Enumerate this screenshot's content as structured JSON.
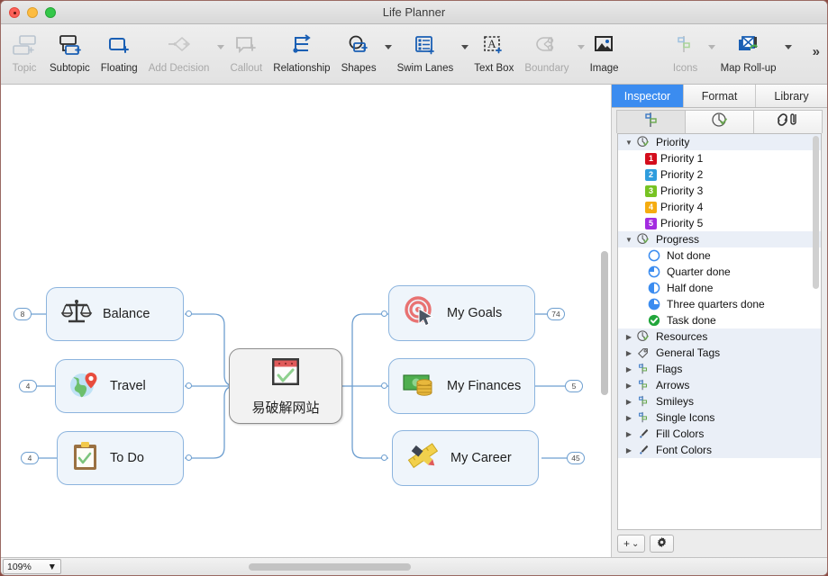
{
  "window": {
    "title": "Life Planner"
  },
  "traffic_lights": [
    {
      "name": "close",
      "color": "#fc6058"
    },
    {
      "name": "minimize",
      "color": "#fdbc40"
    },
    {
      "name": "zoom",
      "color": "#34c749"
    }
  ],
  "toolbar": {
    "items": [
      {
        "label": "Topic",
        "icon": "add-topic-icon",
        "enabled": false,
        "caret": false
      },
      {
        "label": "Subtopic",
        "icon": "add-subtopic-icon",
        "enabled": true,
        "caret": false
      },
      {
        "label": "Floating",
        "icon": "floating-topic-icon",
        "enabled": true,
        "caret": false
      },
      {
        "label": "Add Decision",
        "icon": "add-decision-icon",
        "enabled": false,
        "caret": true
      },
      {
        "label": "Callout",
        "icon": "callout-icon",
        "enabled": false,
        "caret": false
      },
      {
        "label": "Relationship",
        "icon": "relationship-icon",
        "enabled": true,
        "caret": false
      },
      {
        "label": "Shapes",
        "icon": "shapes-icon",
        "enabled": true,
        "caret": true
      },
      {
        "label": "Swim Lanes",
        "icon": "swim-lanes-icon",
        "enabled": true,
        "caret": true
      },
      {
        "label": "Text Box",
        "icon": "text-box-icon",
        "enabled": true,
        "caret": false
      },
      {
        "label": "Boundary",
        "icon": "boundary-icon",
        "enabled": false,
        "caret": true
      },
      {
        "label": "Image",
        "icon": "image-icon",
        "enabled": true,
        "caret": false
      },
      {
        "label": "Icons",
        "icon": "icons-icon",
        "enabled": false,
        "caret": true
      },
      {
        "label": "Map Roll-up",
        "icon": "map-rollup-icon",
        "enabled": true,
        "caret": true
      }
    ],
    "overflow_label": "»"
  },
  "canvas": {
    "center_node": {
      "label": "易破解网站",
      "icon": "calendar-check-icon"
    },
    "left_nodes": [
      {
        "label": "Balance",
        "icon": "scales-icon",
        "badge": "8"
      },
      {
        "label": "Travel",
        "icon": "globe-pin-icon",
        "badge": "4"
      },
      {
        "label": "To Do",
        "icon": "clipboard-check-icon",
        "badge": "4"
      }
    ],
    "right_nodes": [
      {
        "label": "My Goals",
        "icon": "target-cursor-icon",
        "badge": "74"
      },
      {
        "label": "My Finances",
        "icon": "money-coins-icon",
        "badge": "5"
      },
      {
        "label": "My Career",
        "icon": "ruler-pencil-icon",
        "badge": "45"
      }
    ]
  },
  "inspector": {
    "tabs": [
      {
        "label": "Inspector",
        "active": true
      },
      {
        "label": "Format",
        "active": false
      },
      {
        "label": "Library",
        "active": false
      }
    ],
    "subtabs": [
      {
        "icon": "markers-icon",
        "active": true
      },
      {
        "icon": "progress-icon",
        "active": false
      },
      {
        "icon": "link-attachment-icon",
        "active": false
      }
    ],
    "groups": [
      {
        "label": "Priority",
        "icon": "progress-clock-icon",
        "expanded": true,
        "items": [
          {
            "label": "Priority 1",
            "icon": "priority-box-1",
            "badge": "1",
            "color": "#d40d1c"
          },
          {
            "label": "Priority 2",
            "icon": "priority-box-2",
            "badge": "2",
            "color": "#2f9ddd"
          },
          {
            "label": "Priority 3",
            "icon": "priority-box-3",
            "badge": "3",
            "color": "#77c323"
          },
          {
            "label": "Priority 4",
            "icon": "priority-box-4",
            "badge": "4",
            "color": "#f5ac10"
          },
          {
            "label": "Priority 5",
            "icon": "priority-box-5",
            "badge": "5",
            "color": "#a32ce0"
          }
        ]
      },
      {
        "label": "Progress",
        "icon": "progress-clock-icon",
        "expanded": true,
        "items": [
          {
            "label": "Not done",
            "icon": "progress-0-icon",
            "fill": 0
          },
          {
            "label": "Quarter done",
            "icon": "progress-25-icon",
            "fill": 25
          },
          {
            "label": "Half done",
            "icon": "progress-50-icon",
            "fill": 50
          },
          {
            "label": "Three quarters done",
            "icon": "progress-75-icon",
            "fill": 75
          },
          {
            "label": "Task done",
            "icon": "task-done-icon",
            "fill": 100
          }
        ]
      },
      {
        "label": "Resources",
        "icon": "progress-clock-icon",
        "expanded": false,
        "items": []
      },
      {
        "label": "General Tags",
        "icon": "tag-icon",
        "expanded": false,
        "items": []
      },
      {
        "label": "Flags",
        "icon": "markers-icon",
        "expanded": false,
        "items": []
      },
      {
        "label": "Arrows",
        "icon": "markers-icon",
        "expanded": false,
        "items": []
      },
      {
        "label": "Smileys",
        "icon": "markers-icon",
        "expanded": false,
        "items": []
      },
      {
        "label": "Single Icons",
        "icon": "markers-icon",
        "expanded": false,
        "items": []
      },
      {
        "label": "Fill Colors",
        "icon": "brush-icon",
        "expanded": false,
        "items": []
      },
      {
        "label": "Font Colors",
        "icon": "brush-icon",
        "expanded": false,
        "items": []
      }
    ],
    "footer": {
      "add_label": "+",
      "add_caret": "⌄",
      "settings_icon": "gear-icon"
    }
  },
  "statusbar": {
    "zoom_level": "109%"
  }
}
